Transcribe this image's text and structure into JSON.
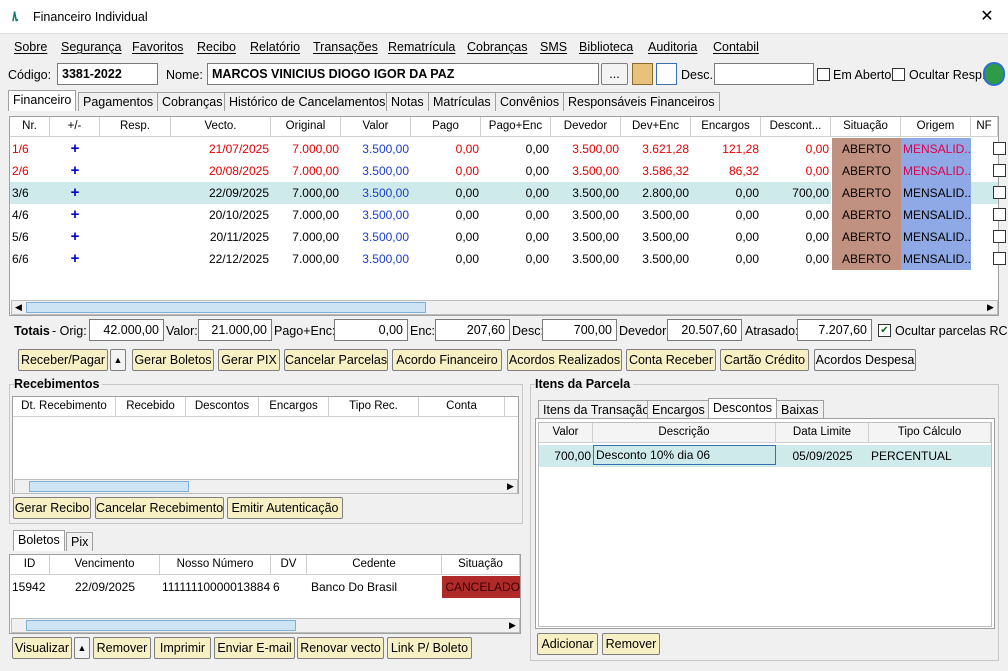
{
  "window": {
    "title": "Financeiro Individual",
    "close": "✕"
  },
  "menu": [
    "Sobre",
    "Segurança",
    "Favoritos",
    "Recibo",
    "Relatório",
    "Transações",
    "Rematrícula",
    "Cobranças",
    "SMS",
    "Biblioteca",
    "Auditoria",
    "Contabil"
  ],
  "header": {
    "codigo_label": "Código:",
    "codigo": "3381-2022",
    "nome_label": "Nome:",
    "nome": "MARCOS VINICIUS DIOGO IGOR DA PAZ",
    "ellipsis": "...",
    "desc_label": "Desc.:",
    "desc": "",
    "em_aberto": "Em Aberto",
    "ocultar_resp": "Ocultar Resp."
  },
  "tabs": [
    "Financeiro",
    "Pagamentos",
    "Cobranças",
    "Histórico de Cancelamentos",
    "Notas",
    "Matrículas",
    "Convênios",
    "Responsáveis Financeiros"
  ],
  "parcelas": {
    "columns": [
      "Nr.",
      "+/-",
      "Resp.",
      "Vecto.",
      "Original",
      "Valor",
      "Pago",
      "Pago+Enc",
      "Devedor",
      "Dev+Enc",
      "Encargos",
      "Descont...",
      "Situação",
      "Origem",
      "NF"
    ],
    "rows": [
      {
        "nr": "1/6",
        "plus": "+",
        "resp": "",
        "vecto": "21/07/2025",
        "original": "7.000,00",
        "valor": "3.500,00",
        "pago": "0,00",
        "pago_enc": "0,00",
        "devedor": "3.500,00",
        "dev_enc": "3.621,28",
        "encargos": "121,28",
        "desconto": "0,00",
        "situacao": "ABERTO",
        "origem": "MENSALID...",
        "late": true
      },
      {
        "nr": "2/6",
        "plus": "+",
        "resp": "",
        "vecto": "20/08/2025",
        "original": "7.000,00",
        "valor": "3.500,00",
        "pago": "0,00",
        "pago_enc": "0,00",
        "devedor": "3.500,00",
        "dev_enc": "3.586,32",
        "encargos": "86,32",
        "desconto": "0,00",
        "situacao": "ABERTO",
        "origem": "MENSALID...",
        "late": true
      },
      {
        "nr": "3/6",
        "plus": "+",
        "resp": "",
        "vecto": "22/09/2025",
        "original": "7.000,00",
        "valor": "3.500,00",
        "pago": "0,00",
        "pago_enc": "0,00",
        "devedor": "3.500,00",
        "dev_enc": "2.800,00",
        "encargos": "0,00",
        "desconto": "700,00",
        "situacao": "ABERTO",
        "origem": "MENSALID...",
        "late": false,
        "selected": true
      },
      {
        "nr": "4/6",
        "plus": "+",
        "resp": "",
        "vecto": "20/10/2025",
        "original": "7.000,00",
        "valor": "3.500,00",
        "pago": "0,00",
        "pago_enc": "0,00",
        "devedor": "3.500,00",
        "dev_enc": "3.500,00",
        "encargos": "0,00",
        "desconto": "0,00",
        "situacao": "ABERTO",
        "origem": "MENSALID...",
        "late": false
      },
      {
        "nr": "5/6",
        "plus": "+",
        "resp": "",
        "vecto": "20/11/2025",
        "original": "7.000,00",
        "valor": "3.500,00",
        "pago": "0,00",
        "pago_enc": "0,00",
        "devedor": "3.500,00",
        "dev_enc": "3.500,00",
        "encargos": "0,00",
        "desconto": "0,00",
        "situacao": "ABERTO",
        "origem": "MENSALID...",
        "late": false
      },
      {
        "nr": "6/6",
        "plus": "+",
        "resp": "",
        "vecto": "22/12/2025",
        "original": "7.000,00",
        "valor": "3.500,00",
        "pago": "0,00",
        "pago_enc": "0,00",
        "devedor": "3.500,00",
        "dev_enc": "3.500,00",
        "encargos": "0,00",
        "desconto": "0,00",
        "situacao": "ABERTO",
        "origem": "MENSALID...",
        "late": false
      }
    ]
  },
  "totais": {
    "label": "Totais",
    "orig_label": "- Orig:",
    "orig": "42.000,00",
    "valor_label": "Valor:",
    "valor": "21.000,00",
    "pago_enc_label": "Pago+Enc:",
    "pago_enc": "0,00",
    "enc_label": "Enc:",
    "enc": "207,60",
    "desc_label": "Desc:",
    "desc": "700,00",
    "devedor_label": "Devedor:",
    "devedor": "20.507,60",
    "atrasado_label": "Atrasado:",
    "atrasado": "7.207,60",
    "ocultar": "Ocultar parcelas RC"
  },
  "actions": [
    "Receber/Pagar",
    "Gerar Boletos",
    "Gerar PIX",
    "Cancelar Parcelas",
    "Acordo Financeiro",
    "Acordos Realizados",
    "Conta Receber",
    "Cartão Crédito",
    "Acordos Despesa"
  ],
  "recebimentos": {
    "title": "Recebimentos",
    "columns": [
      "Dt. Recebimento",
      "Recebido",
      "Descontos",
      "Encargos",
      "Tipo Rec.",
      "Conta"
    ],
    "buttons": [
      "Gerar Recibo",
      "Cancelar Recebimento",
      "Emitir Autenticação"
    ]
  },
  "itens": {
    "title": "Itens da Parcela",
    "tabs": [
      "Itens da Transação",
      "Encargos",
      "Descontos",
      "Baixas"
    ],
    "columns": [
      "Valor",
      "Descrição",
      "Data Limite",
      "Tipo Cálculo"
    ],
    "rows": [
      {
        "valor": "700,00",
        "descricao": "Desconto 10% dia 06",
        "data": "05/09/2025",
        "tipo": "PERCENTUAL"
      }
    ],
    "buttons": [
      "Adicionar",
      "Remover"
    ]
  },
  "boletos": {
    "tabs": [
      "Boletos",
      "Pix"
    ],
    "columns": [
      "ID",
      "Vencimento",
      "Nosso Número",
      "DV",
      "Cedente",
      "Situação"
    ],
    "rows": [
      {
        "id": "15942",
        "venc": "22/09/2025",
        "nosso": "11111110000013884",
        "dv": "6",
        "cedente": "Banco Do Brasil",
        "situacao": "CANCELADO"
      }
    ],
    "buttons": [
      "Visualizar",
      "Remover",
      "Imprimir",
      "Enviar E-mail",
      "Renovar vecto",
      "Link P/ Boleto"
    ]
  }
}
